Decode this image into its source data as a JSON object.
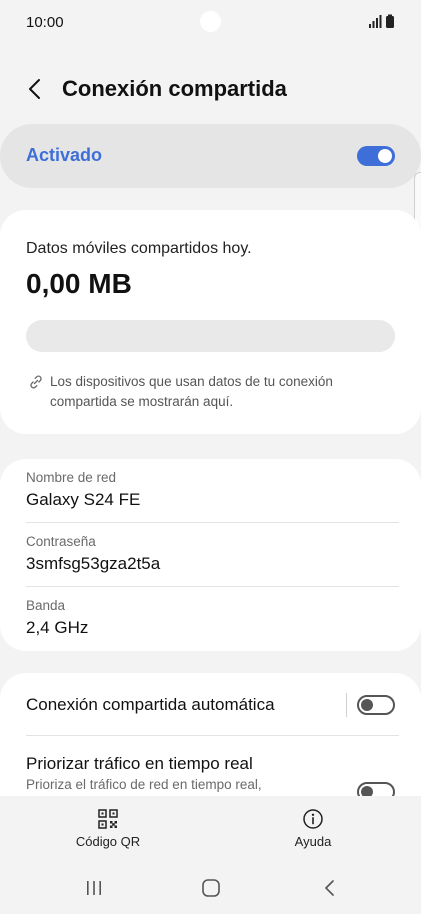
{
  "status": {
    "time": "10:00"
  },
  "header": {
    "title": "Conexión compartida"
  },
  "master": {
    "label": "Activado",
    "enabled": true
  },
  "usage": {
    "label": "Datos móviles compartidos hoy.",
    "value": "0,00 MB",
    "progress_fraction": 0,
    "info": "Los dispositivos que usan datos de tu conexión compartida se mostrarán aquí."
  },
  "network": {
    "name_label": "Nombre de red",
    "name_value": "Galaxy S24 FE",
    "password_label": "Contraseña",
    "password_value": "3smfsg53gza2t5a",
    "band_label": "Banda",
    "band_value": "2,4 GHz"
  },
  "options": {
    "auto_label": "Conexión compartida automática",
    "auto_enabled": false,
    "priority_label": "Priorizar tráfico en tiempo real",
    "priority_sub": "Prioriza el tráfico de red en tiempo real,",
    "priority_enabled": false
  },
  "actions": {
    "qr_label": "Código QR",
    "help_label": "Ayuda"
  },
  "colors": {
    "accent": "#3e6fd8",
    "background": "#f3f3f3",
    "card": "#ffffff"
  },
  "icons": {
    "back": "chevron-left-icon",
    "link": "link-icon",
    "qr": "qr-code-icon",
    "help": "info-icon",
    "nav_recents": "recents-icon",
    "nav_home": "home-icon",
    "nav_back": "back-icon"
  }
}
